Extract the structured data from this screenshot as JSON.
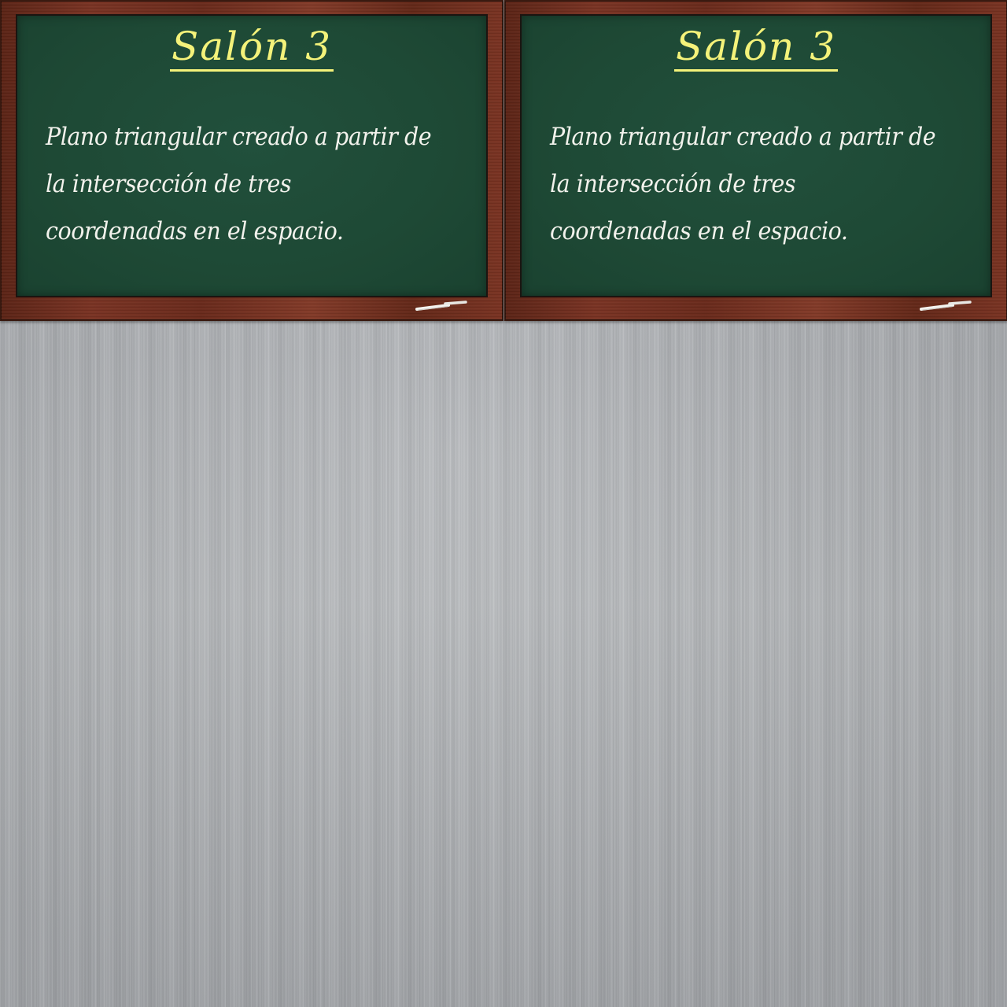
{
  "boards": [
    {
      "title": "Salón 3",
      "text": "Plano triangular creado a partir de la intersección de tres coordenadas en el espacio."
    },
    {
      "title": "Salón 3",
      "text": "Plano triangular creado a partir de la intersección de tres coordenadas en el espacio."
    }
  ],
  "colors": {
    "title": "#f4f27a",
    "chalkboard": "#1e4935",
    "frame": "#7a3323",
    "text": "#f2f2ec",
    "background": "#b4b7ba"
  },
  "icons": {
    "chalk": "chalk-icon"
  }
}
